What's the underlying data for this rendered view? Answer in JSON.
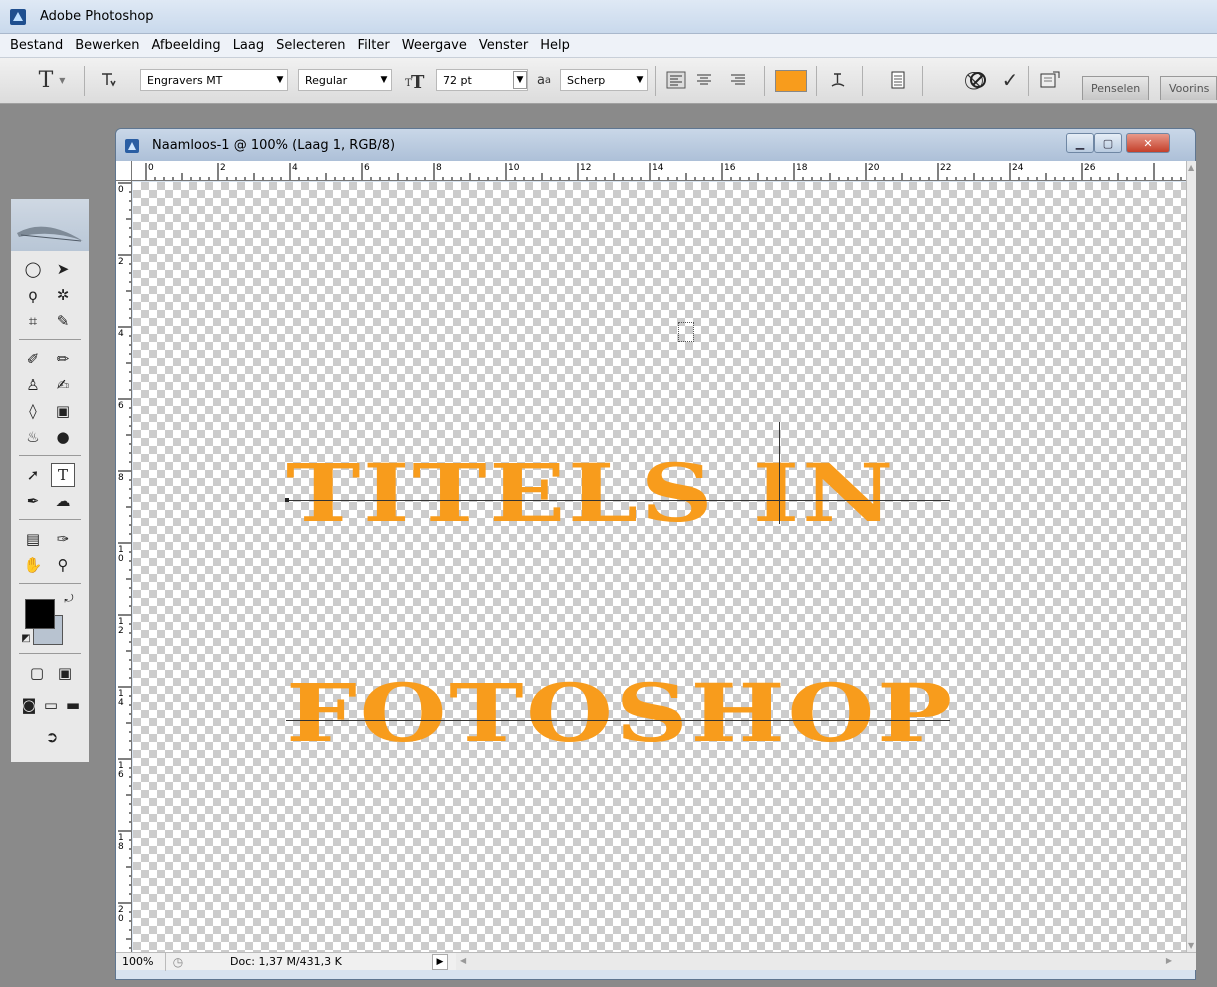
{
  "app": {
    "title": "Adobe Photoshop",
    "menu": [
      "Bestand",
      "Bewerken",
      "Afbeelding",
      "Laag",
      "Selecteren",
      "Filter",
      "Weergave",
      "Venster",
      "Help"
    ]
  },
  "options_bar": {
    "tool_glyph": "T",
    "font_family": "Engravers MT",
    "font_style": "Regular",
    "font_size": "72 pt",
    "antialias_label": "a",
    "antialias_value": "Scherp",
    "text_color": "#f89c1c",
    "panel_tabs": [
      "Penselen",
      "Voorins"
    ]
  },
  "document": {
    "title": "Naamloos-1 @ 100% (Laag 1, RGB/8)",
    "ruler_h_labels": [
      "0",
      "2",
      "4",
      "6",
      "8",
      "10",
      "12",
      "14",
      "16",
      "18",
      "20",
      "22",
      "24",
      "26"
    ],
    "ruler_v_labels": [
      "0",
      "2",
      "4",
      "6",
      "8",
      "1 0",
      "1 2",
      "1 4",
      "1 6",
      "1 8",
      "2 0"
    ],
    "text_line_1": "TITELS  IN",
    "text_line_2": "FOTOSHOP",
    "zoom": "100%",
    "doc_info": "Doc: 1,37 M/431,3 K"
  },
  "icons": {
    "app": "photoshop-icon",
    "cancel": "cancel-icon",
    "commit": "commit-icon"
  }
}
